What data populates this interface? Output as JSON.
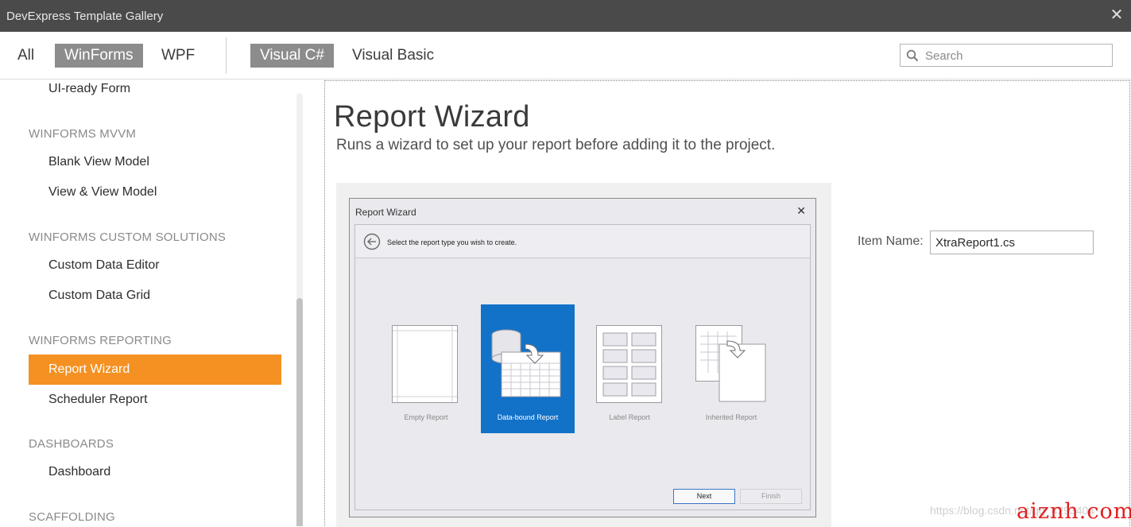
{
  "window": {
    "title": "DevExpress Template Gallery"
  },
  "toolbar": {
    "platforms": [
      {
        "label": "All",
        "active": false
      },
      {
        "label": "WinForms",
        "active": true
      },
      {
        "label": "WPF",
        "active": false
      }
    ],
    "languages": [
      {
        "label": "Visual C#",
        "active": true
      },
      {
        "label": "Visual Basic",
        "active": false
      }
    ],
    "search": {
      "placeholder": "Search",
      "value": ""
    }
  },
  "sidebar": {
    "partial_item": "UI-ready Form",
    "groups": [
      {
        "title": "WINFORMS MVVM",
        "items": [
          "Blank View Model",
          "View & View Model"
        ]
      },
      {
        "title": "WINFORMS CUSTOM SOLUTIONS",
        "items": [
          "Custom Data Editor",
          "Custom Data Grid"
        ]
      },
      {
        "title": "WINFORMS REPORTING",
        "items": [
          "Report Wizard",
          "Scheduler Report"
        ]
      },
      {
        "title": "DASHBOARDS",
        "items": [
          "Dashboard"
        ]
      },
      {
        "title": "SCAFFOLDING",
        "items": []
      }
    ],
    "selected": "Report Wizard"
  },
  "main": {
    "title": "Report Wizard",
    "description": "Runs a wizard to set up your report before adding it to the project.",
    "preview": {
      "dialog_title": "Report Wizard",
      "prompt": "Select the report type you wish to create.",
      "report_types": [
        "Empty Report",
        "Data-bound Report",
        "Label Report",
        "Inherited Report"
      ],
      "selected_type": "Data-bound Report",
      "next_label": "Next",
      "finish_label": "Finish"
    },
    "item_name": {
      "label": "Item Name:",
      "value": "XtraReport1.cs"
    }
  },
  "overlay": {
    "watermark": "https://blog.csdn.net/qq_4293404",
    "brand": "aiznh.com"
  },
  "colors": {
    "accent_orange": "#F49122",
    "selected_blue": "#1272C8",
    "titlebar": "#4A4A4A",
    "toggle_active": "#8C8C8C"
  }
}
